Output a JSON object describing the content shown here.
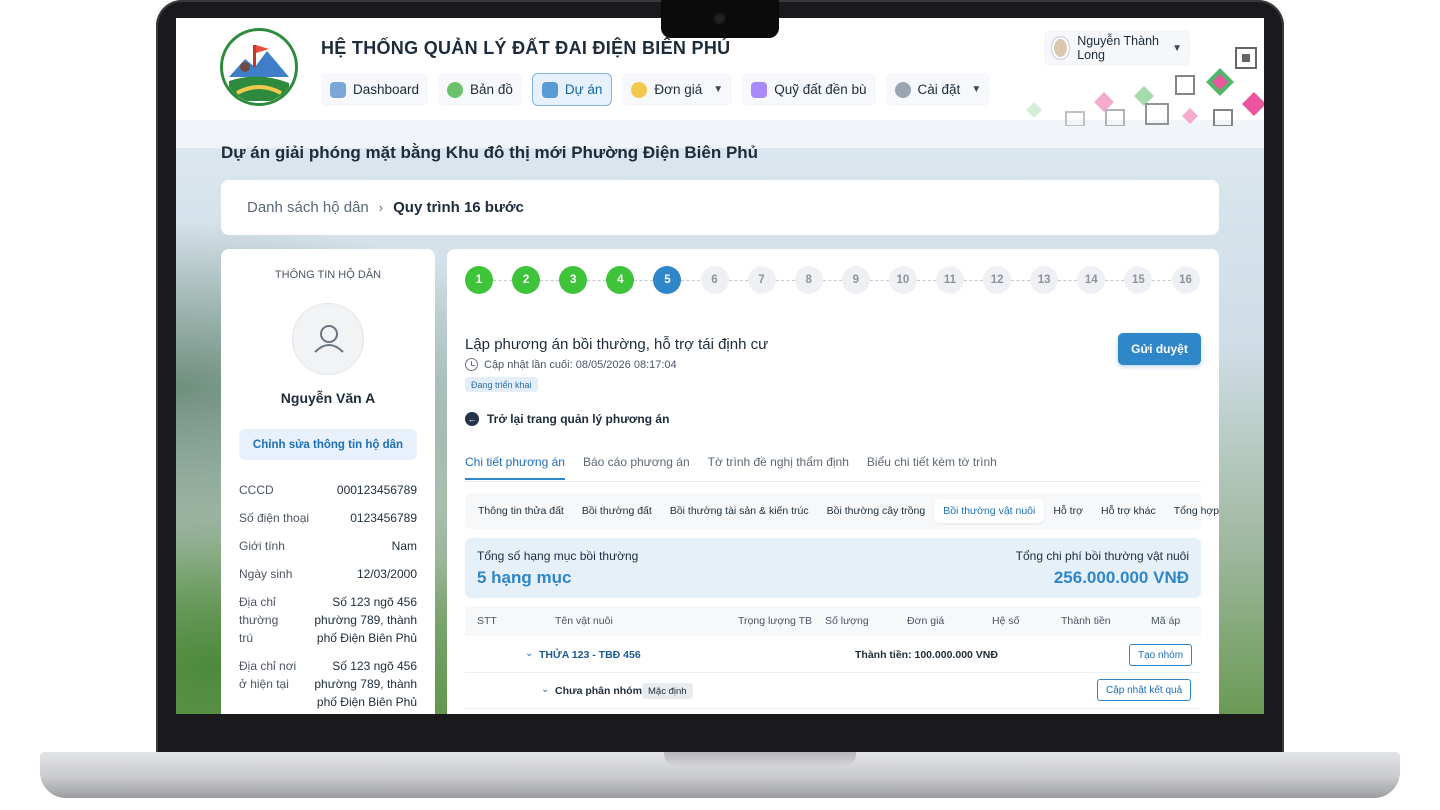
{
  "app": {
    "title": "HỆ THỐNG QUẢN LÝ ĐẤT ĐAI ĐIỆN BIÊN PHỦ",
    "user_name": "Nguyễn Thành Long"
  },
  "nav": [
    {
      "label": "Dashboard",
      "icon": "dashboard-icon",
      "color": "#7aa7d6"
    },
    {
      "label": "Bản đồ",
      "icon": "map-icon",
      "color": "#6cc26a"
    },
    {
      "label": "Dự án",
      "icon": "project-icon",
      "color": "#5b9bd5"
    },
    {
      "label": "Đơn giá",
      "icon": "price-icon",
      "color": "#f2c94c"
    },
    {
      "label": "Quỹ đất đền bù",
      "icon": "land-fund-icon",
      "color": "#a78bfa"
    },
    {
      "label": "Cài đặt",
      "icon": "settings-icon",
      "color": "#9aa5b1"
    }
  ],
  "page": {
    "title": "Dự án giải phóng mặt bằng Khu đô thị mới Phường Điện Biên Phủ",
    "breadcrumb": [
      "Danh sách hộ dân",
      "Quy trình 16 bước"
    ]
  },
  "household": {
    "header": "THÔNG TIN HỘ DÂN",
    "name": "Nguyễn Văn A",
    "edit_label": "Chỉnh sửa thông tin hộ dân",
    "fields": [
      {
        "label": "CCCD",
        "value": "000123456789"
      },
      {
        "label": "Số điện thoại",
        "value": "0123456789"
      },
      {
        "label": "Giới tính",
        "value": "Nam"
      },
      {
        "label": "Ngày sinh",
        "value": "12/03/2000"
      },
      {
        "label": "Địa chỉ thường trú",
        "value": "Số 123 ngõ 456 phường 789, thành phố Điện Biên Phủ"
      },
      {
        "label": "Địa chỉ nơi ở hiện tại",
        "value": "Số 123 ngõ 456 phường 789, thành phố Điện Biên Phủ"
      }
    ]
  },
  "steps": {
    "labels": [
      "1",
      "2",
      "3",
      "4",
      "5",
      "6",
      "7",
      "8",
      "9",
      "10",
      "11",
      "12",
      "13",
      "14",
      "15",
      "16"
    ],
    "completed": 4,
    "current": 5
  },
  "plan": {
    "title": "Lập phương án bồi thường, hỗ trợ tái định cư",
    "updated": "Cập nhật lần cuối: 08/05/2026 08:17:04",
    "status": "Đang triển khai",
    "submit_label": "Gửi duyệt",
    "back_label": "Trở lại trang quản lý phương án"
  },
  "tabs": [
    "Chi tiết phương án",
    "Báo cáo phương án",
    "Tờ trình đề nghị thẩm định",
    "Biểu chi tiết kèm tờ trình"
  ],
  "subtabs": [
    "Thông tin thửa đất",
    "Bồi thường đất",
    "Bồi thường tài sản & kiến trúc",
    "Bồi thường cây trồng",
    "Bồi thường vật nuôi",
    "Hỗ trợ",
    "Hỗ trợ khác",
    "Tổng hợp"
  ],
  "summary": {
    "count_label": "Tổng số hạng mục bồi thường",
    "count_value": "5 hạng mục",
    "total_label": "Tổng chi phí bồi thường vật nuôi",
    "total_value": "256.000.000 VNĐ"
  },
  "table": {
    "columns": [
      "STT",
      "Tên vật nuôi",
      "Trọng lượng TB",
      "Số lượng",
      "Đơn giá",
      "Hệ số",
      "Thành tiền",
      "Mã áp"
    ],
    "group": {
      "label": "THỬA 123 - TBĐ 456",
      "total": "Thành tiền: 100.000.000 VNĐ",
      "button": "Tạo nhóm"
    },
    "subgroup": {
      "label": "Chưa phân nhóm",
      "tag": "Mặc định",
      "button": "Cập nhật kết quả"
    }
  },
  "colors": {
    "primary": "#2f86c9",
    "done": "#3fc33a",
    "brand_green": "#2e8b3d"
  }
}
